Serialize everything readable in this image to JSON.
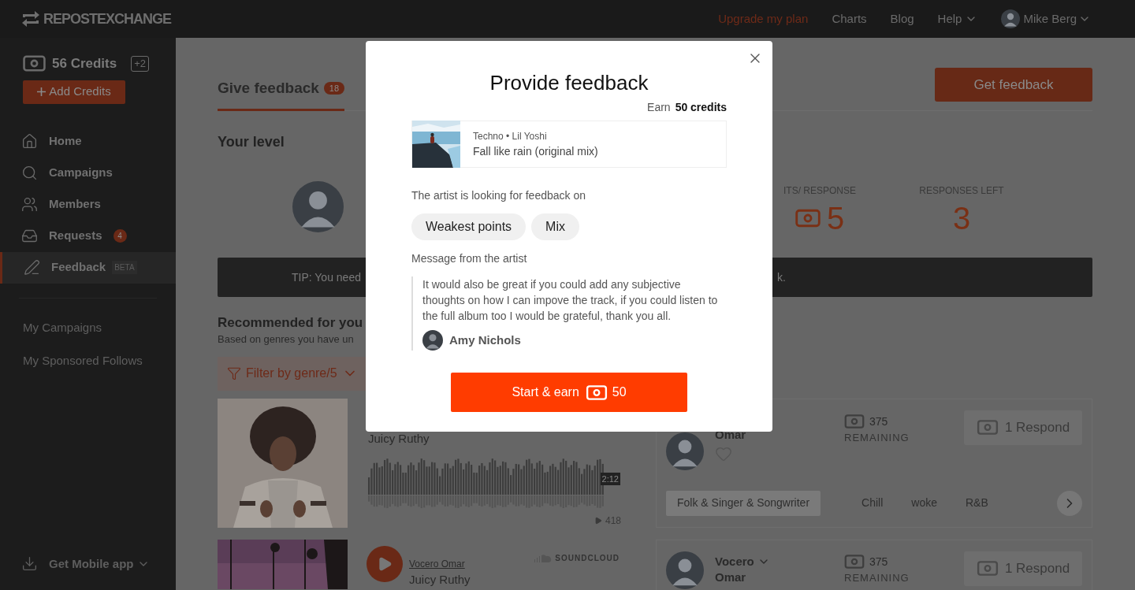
{
  "topbar": {
    "logo": "REPOSTEXCHANGE",
    "links": [
      {
        "label": "Upgrade my plan",
        "kind": "upgrade"
      },
      {
        "label": "Charts",
        "kind": "link"
      },
      {
        "label": "Blog",
        "kind": "link"
      },
      {
        "label": "Help",
        "kind": "menu"
      }
    ],
    "user": "Mike Berg"
  },
  "sidebar": {
    "credits": "56 Credits",
    "bonus": "+2",
    "add_credits": "Add Credits",
    "items": [
      {
        "label": "Home",
        "selected": false
      },
      {
        "label": "Campaigns",
        "selected": false
      },
      {
        "label": "Members",
        "selected": false
      },
      {
        "label": "Requests",
        "badge": "4",
        "selected": false
      },
      {
        "label": "Feedback",
        "tag": "BETA",
        "selected": true
      }
    ],
    "links": [
      "My Campaigns",
      "My Sponsored Follows"
    ],
    "mobile": "Get Mobile app"
  },
  "main": {
    "tabs": [
      {
        "label": "Give feedback",
        "badge": "18",
        "selected": true
      }
    ],
    "get_feedback": "Get feedback",
    "level_title": "Your level",
    "stats": [
      {
        "label": "ITS/ RESPONSE",
        "value": "5",
        "kind": "credits"
      },
      {
        "label": "RESPONSES LEFT",
        "value": "3",
        "kind": "plain"
      }
    ],
    "tip_start": "TIP: You need",
    "tip_end": "k.",
    "recommended": {
      "title": "Recommended for you",
      "subtitle": "Based on genres you have un",
      "filter": "Filter by genre/5"
    },
    "tracks": [
      {
        "title": "Juicy Ruthy",
        "duration": "2:12",
        "plays": "418",
        "member": "Omar",
        "remaining": "375",
        "remaining_label": "REMAINING",
        "respond": "1 Respond",
        "tags": [
          {
            "label": "Folk & Singer & Songwriter",
            "selected": true
          },
          {
            "label": "Chill",
            "selected": false
          },
          {
            "label": "woke",
            "selected": false
          },
          {
            "label": "R&B",
            "selected": false
          }
        ]
      },
      {
        "artist": "Vocero Omar",
        "title": "Juicy Ruthy",
        "source": "SOUNDCLOUD",
        "member_first": "Vocero",
        "member": "Omar",
        "remaining": "375",
        "remaining_label": "REMAINING",
        "respond": "1 Respond"
      }
    ]
  },
  "modal": {
    "title": "Provide feedback",
    "earn_label": "Earn",
    "earn_value": "50 credits",
    "track_meta": "Techno • Lil Yoshi",
    "track_title": "Fall like rain (original mix)",
    "looking_for": "The artist is looking for feedback on",
    "chips": [
      "Weakest points",
      "Mix"
    ],
    "message_label": "Message from the artist",
    "message": "It would also be great if you could add any subjective thoughts on how I can impove the track, if you could listen to the full album too I would be grateful, thank you all.",
    "author": "Amy Nichols",
    "button_label": "Start & earn",
    "button_value": "50"
  }
}
